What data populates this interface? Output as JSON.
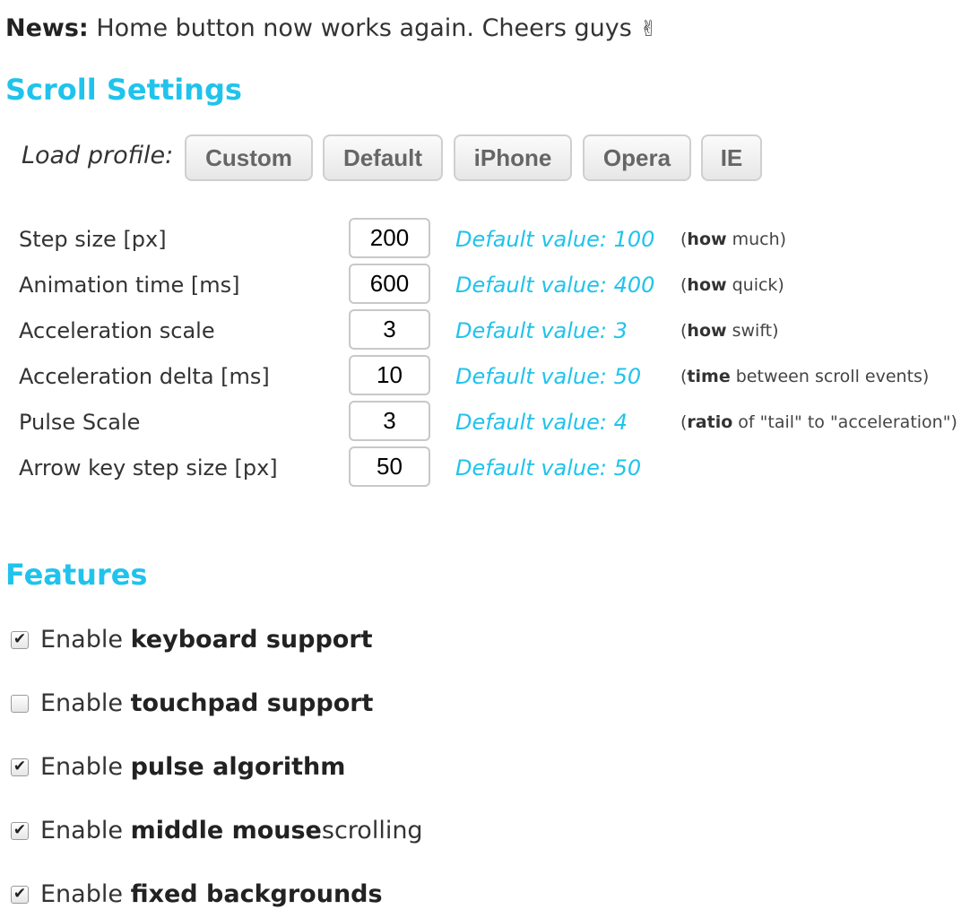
{
  "news": {
    "label": "News:",
    "text": " Home button now works again. Cheers guys ",
    "emoji": "✌"
  },
  "scroll_settings": {
    "title": "Scroll Settings",
    "profile_label": "Load profile:",
    "profiles": [
      "Custom",
      "Default",
      "iPhone",
      "Opera",
      "IE"
    ],
    "rows": [
      {
        "label": "Step size [px]",
        "value": "200",
        "default": "Default value: 100",
        "hint_bold": "how",
        "hint_rest": " much)"
      },
      {
        "label": "Animation time [ms]",
        "value": "600",
        "default": "Default value: 400",
        "hint_bold": "how",
        "hint_rest": " quick)"
      },
      {
        "label": "Acceleration scale",
        "value": "3",
        "default": "Default value: 3",
        "hint_bold": "how",
        "hint_rest": " swift)"
      },
      {
        "label": "Acceleration delta [ms]",
        "value": "10",
        "default": "Default value: 50",
        "hint_bold": "time",
        "hint_rest": " between scroll events)"
      },
      {
        "label": "Pulse Scale",
        "value": "3",
        "default": "Default value: 4",
        "hint_bold": "ratio",
        "hint_rest": " of \"tail\" to \"acceleration\")"
      },
      {
        "label": "Arrow key step size [px]",
        "value": "50",
        "default": "Default value: 50",
        "hint_bold": "",
        "hint_rest": ""
      }
    ]
  },
  "features": {
    "title": "Features",
    "items": [
      {
        "prefix": "Enable ",
        "bold": "keyboard support",
        "suffix": "",
        "checked": true
      },
      {
        "prefix": "Enable ",
        "bold": "touchpad support",
        "suffix": "",
        "checked": false
      },
      {
        "prefix": "Enable ",
        "bold": "pulse algorithm",
        "suffix": "",
        "checked": true
      },
      {
        "prefix": "Enable ",
        "bold": "middle mouse",
        "suffix": " scrolling",
        "checked": true
      },
      {
        "prefix": "Enable ",
        "bold": "fixed backgrounds",
        "suffix": "",
        "checked": true
      }
    ]
  },
  "colors": {
    "accent": "#20c3ec",
    "text": "#333333",
    "button_text": "#666666"
  },
  "icons": {
    "checkbox_checked": "check-icon"
  }
}
